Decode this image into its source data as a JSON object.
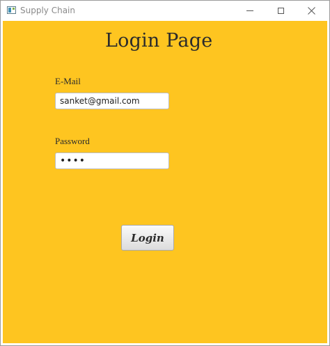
{
  "window": {
    "title": "Supply Chain",
    "icons": {
      "app": "app-window-icon",
      "minimize": "minimize-icon",
      "maximize": "maximize-icon",
      "close": "close-icon"
    }
  },
  "page": {
    "heading": "Login Page",
    "background_color": "#fec520"
  },
  "form": {
    "email": {
      "label": "E-Mail",
      "value": "sanket@gmail.com"
    },
    "password": {
      "label": "Password",
      "value": "••••"
    },
    "login_label": "Login"
  }
}
